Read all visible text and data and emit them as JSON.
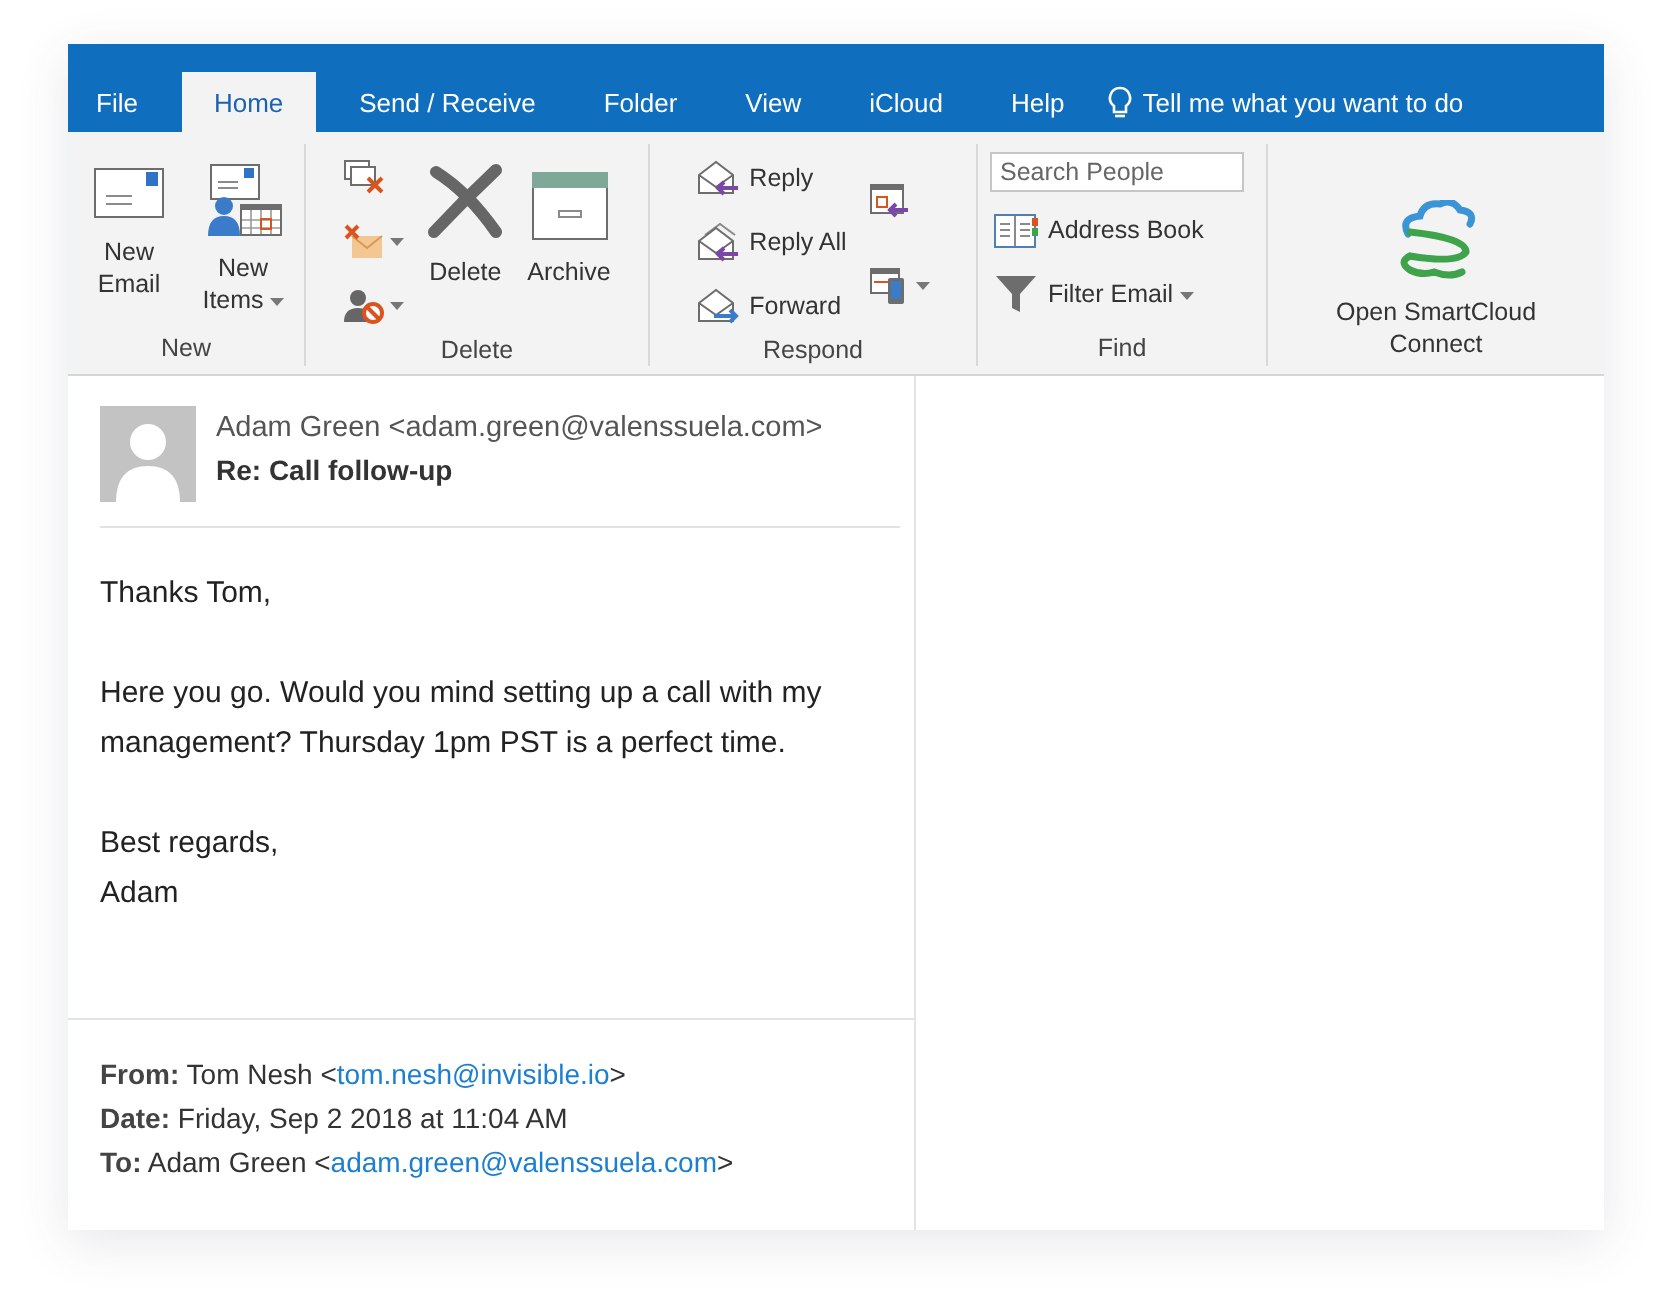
{
  "tabs": [
    {
      "label": "File",
      "selected": false
    },
    {
      "label": "Home",
      "selected": true
    },
    {
      "label": "Send / Receive",
      "selected": false
    },
    {
      "label": "Folder",
      "selected": false
    },
    {
      "label": "View",
      "selected": false
    },
    {
      "label": "iCloud",
      "selected": false
    },
    {
      "label": "Help",
      "selected": false
    }
  ],
  "tell_me": {
    "text": "Tell me what you want to do"
  },
  "ribbon": {
    "groups": [
      {
        "label": "New",
        "columns": [
          [
            {
              "kind": "large",
              "label": "New Email"
            }
          ],
          [
            {
              "kind": "large",
              "label": "New Items",
              "dropdown": true
            }
          ]
        ]
      },
      {
        "label": "Delete",
        "columns": [
          [
            {
              "kind": "icon",
              "dropdown": false
            },
            {
              "kind": "icon",
              "dropdown": true
            },
            {
              "kind": "icon",
              "dropdown": true
            }
          ],
          [
            {
              "kind": "large",
              "label": "Delete"
            }
          ],
          [
            {
              "kind": "large",
              "label": "Archive"
            }
          ]
        ]
      },
      {
        "label": "Respond",
        "columns": [
          [
            {
              "kind": "small",
              "label": "Reply"
            },
            {
              "kind": "small",
              "label": "Reply All"
            },
            {
              "kind": "small",
              "label": "Forward"
            }
          ],
          [
            {
              "kind": "icon",
              "dropdown": false
            },
            {
              "kind": "icon",
              "dropdown": true
            }
          ]
        ]
      },
      {
        "label": "Find",
        "columns": [
          [
            {
              "kind": "search",
              "placeholder": "Search People"
            },
            {
              "kind": "small",
              "label": "Address Book"
            },
            {
              "kind": "small",
              "label": "Filter Email",
              "dropdown": true
            }
          ]
        ]
      },
      {
        "columns": [
          [
            {
              "kind": "large",
              "label": "Open SmartCloud Connect"
            }
          ]
        ]
      }
    ]
  },
  "message": {
    "sender": "Adam Green <adam.green@valenssuela.com>",
    "subject": "Re: Call follow-up",
    "paragraphs": [
      [
        "Thanks Tom,"
      ],
      [
        "Here you go. Would you mind setting up a call with my management? Thursday 1pm PST is a perfect time."
      ],
      [
        "Best regards,",
        "Adam"
      ]
    ],
    "quoted_header": [
      {
        "label": "From:",
        "before": "Tom Nesh <",
        "email": "tom.nesh@invisible.io",
        "after": ">"
      },
      {
        "label": "Date:",
        "before": "Friday, Sep 2 2018 at 11:04 AM"
      },
      {
        "label": "To:",
        "before": "Adam Green <",
        "email": "adam.green@valenssuela.com",
        "after": ">"
      }
    ]
  }
}
